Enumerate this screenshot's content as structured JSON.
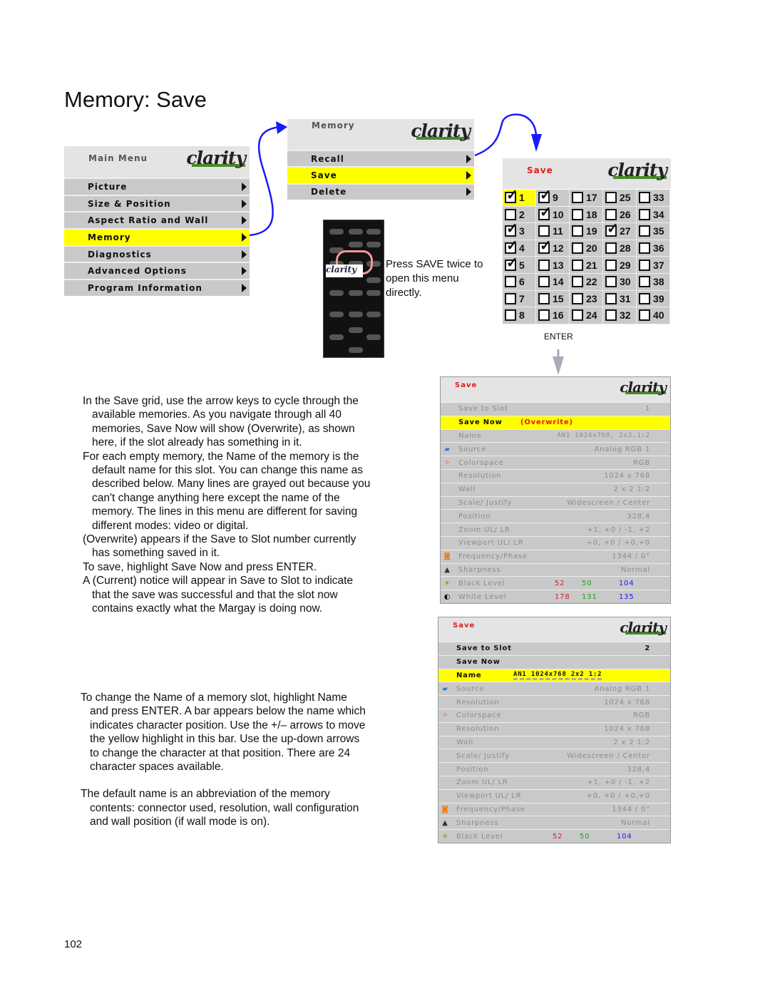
{
  "page": {
    "title": "Memory: Save",
    "page_number": "102"
  },
  "main_menu": {
    "title": "Main Menu",
    "logo": "clarity",
    "items": [
      {
        "label": "Picture",
        "selected": false
      },
      {
        "label": "Size & Position",
        "selected": false
      },
      {
        "label": "Aspect Ratio and Wall",
        "selected": false
      },
      {
        "label": "Memory",
        "selected": true
      },
      {
        "label": "Diagnostics",
        "selected": false
      },
      {
        "label": "Advanced Options",
        "selected": false
      },
      {
        "label": "Program Information",
        "selected": false
      }
    ]
  },
  "memory_menu": {
    "title": "Memory",
    "logo": "clarity",
    "items": [
      {
        "label": "Recall",
        "selected": false
      },
      {
        "label": "Save",
        "selected": true
      },
      {
        "label": "Delete",
        "selected": false
      }
    ]
  },
  "remote": {
    "caption": "Press SAVE twice to open this menu directly.",
    "logo": "clarity",
    "highlighted_button": "SAVE"
  },
  "save_grid": {
    "title": "Save",
    "logo": "clarity",
    "checked": [
      1,
      3,
      4,
      5,
      9,
      10,
      12,
      27
    ],
    "selected": 1,
    "enter_label": "ENTER"
  },
  "save_menu_1": {
    "title": "Save",
    "logo": "clarity",
    "rows": [
      {
        "label": "Save to Slot",
        "value": "1",
        "state": "gray"
      },
      {
        "label": "Save Now",
        "note": "(Overwrite)",
        "state": "highlight"
      },
      {
        "label": "Name",
        "value": "AN1 1024x768, 2x2,1:2",
        "state": "gray"
      },
      {
        "icon": "source-icon",
        "label": "Source",
        "value": "Analog RGB 1",
        "state": "gray"
      },
      {
        "icon": "colorspace-icon",
        "label": "Colorspace",
        "value": "RGB",
        "state": "gray"
      },
      {
        "label": "Resolution",
        "value": "1024 x 768",
        "state": "gray"
      },
      {
        "label": "Wall",
        "value": "2 x 2     1:2",
        "state": "gray"
      },
      {
        "label": "Scale/ Justify",
        "value": "Widescreen / Center",
        "state": "gray"
      },
      {
        "label": "Position",
        "value": "328,4",
        "state": "gray"
      },
      {
        "label": "Zoom UL/ LR",
        "value": "+1, +0  /  -1, +2",
        "state": "gray"
      },
      {
        "label": "Viewport  UL/ LR",
        "value": "+0, +0  / +0,+0",
        "state": "gray"
      },
      {
        "icon": "frequency-icon",
        "label": "Frequency/Phase",
        "value": "1344 / 0°",
        "state": "gray"
      },
      {
        "icon": "sharpness-icon",
        "label": "Sharpness",
        "value": "Normal",
        "state": "gray"
      },
      {
        "icon": "brightness-icon",
        "label": "Black Level",
        "r": "52",
        "g": "50",
        "b": "104",
        "state": "gray"
      },
      {
        "icon": "contrast-icon",
        "label": "White Level",
        "r": "178",
        "g": "131",
        "b": "135",
        "state": "gray"
      }
    ]
  },
  "save_menu_2": {
    "title": "Save",
    "logo": "clarity",
    "rows": [
      {
        "label": "Save to Slot",
        "value": "2",
        "state": "active"
      },
      {
        "label": "Save Now",
        "state": "active"
      },
      {
        "label": "Name",
        "value": "AN1  1024x768    2x2  1:2",
        "state": "highlight"
      },
      {
        "icon": "source-icon",
        "label": "Source",
        "value": "Analog RGB 1",
        "state": "gray"
      },
      {
        "label": "Resolution",
        "value": "1024 x 768",
        "state": "gray"
      },
      {
        "icon": "colorspace-icon",
        "label": "Colorspace",
        "value": "RGB",
        "state": "gray"
      },
      {
        "label": "Resolution",
        "value": "1024 x 768",
        "state": "gray"
      },
      {
        "label": "Wall",
        "value": "2 x 2     1:2",
        "state": "gray"
      },
      {
        "label": "Scale/ Justify",
        "value": "Widescreen / Center",
        "state": "gray"
      },
      {
        "label": "Position",
        "value": "328,4",
        "state": "gray"
      },
      {
        "label": "Zoom UL/ LR",
        "value": "+1, +0  /  -1, +2",
        "state": "gray"
      },
      {
        "label": "Viewport  UL/ LR",
        "value": "+0, +0  / +0,+0",
        "state": "gray"
      },
      {
        "icon": "frequency-icon",
        "label": "Frequency/Phase",
        "value": "1344 / 0°",
        "state": "gray"
      },
      {
        "icon": "sharpness-icon",
        "label": "Sharpness",
        "value": "Normal",
        "state": "gray"
      },
      {
        "icon": "brightness-icon",
        "label": "Black Level",
        "r": "52",
        "g": "50",
        "b": "104",
        "state": "gray"
      }
    ]
  },
  "text1": [
    "In the Save grid, use the arrow keys to cycle through the available memories. As you navigate through all 40 memories, Save Now will show (Overwrite), as shown here, if the slot already has something in it.",
    "For each empty memory, the Name of the memory is the default name for this slot. You can change this name as described below. Many lines are grayed out because you can't change anything here except the name of the memory. The lines in this menu are different for saving different modes: video or digital.",
    "(Overwrite) appears if the Save to Slot number currently has something saved in it.",
    "To save, highlight Save Now and press ENTER.",
    "A (Current) notice will appear in Save to Slot to indicate that the save was successful and that the slot now contains exactly what the Margay is doing now."
  ],
  "text2": [
    "To change the Name of a memory slot, highlight Name and press ENTER. A bar appears below the name which indicates character position. Use the +/– arrows to move the yellow highlight in this bar. Use the up-down arrows to change the character at that position. There are 24 character spaces available.",
    "The default name is an abbreviation of the memory contents: connector used, resolution, wall configuration and wall position (if wall mode is on)."
  ],
  "colors": {
    "highlight": "#ffff00",
    "menu_gray": "#c9c9c9",
    "arrow_blue": "#1a1aff",
    "title_red": "#e31b1b"
  }
}
